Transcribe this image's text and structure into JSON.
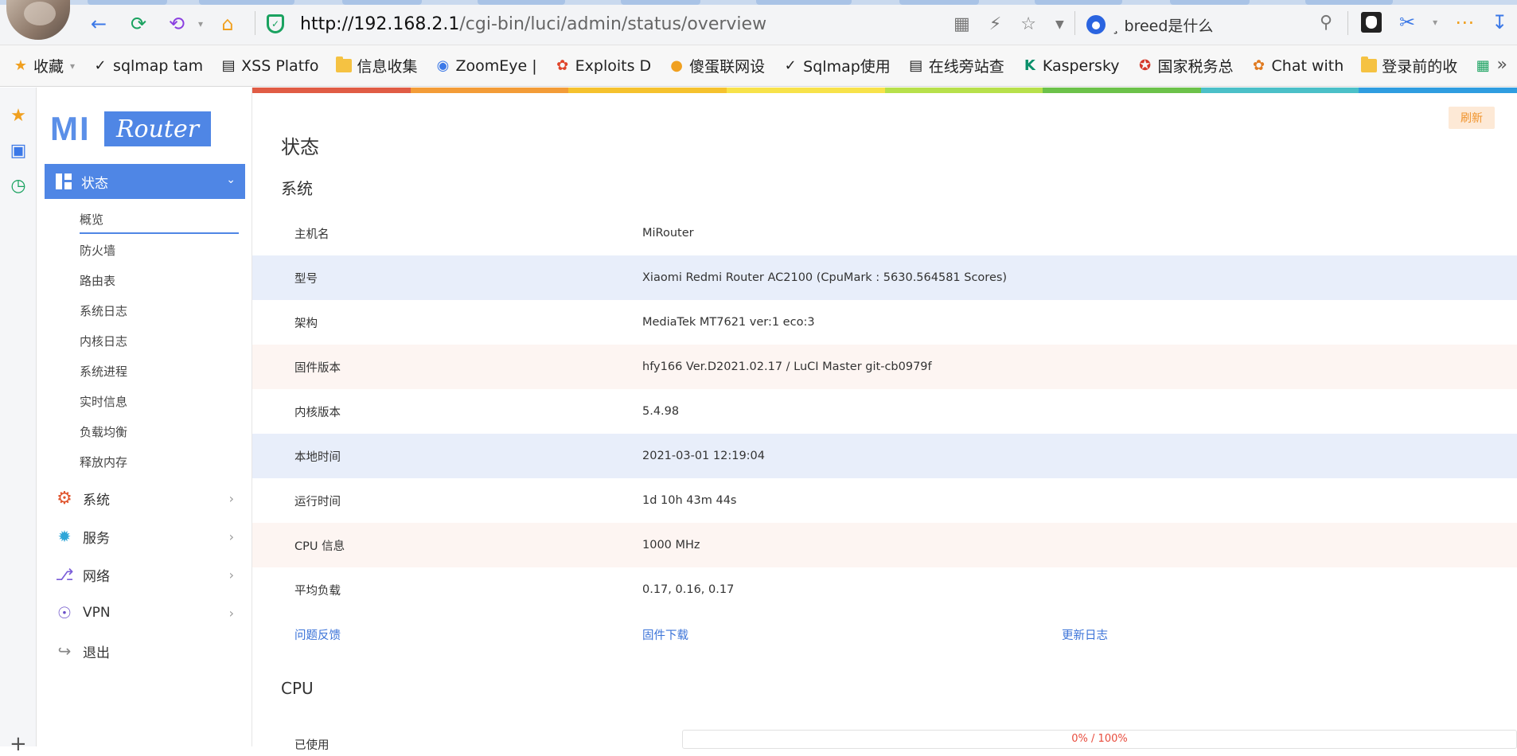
{
  "browser": {
    "url_host": "http://192.168.2.1",
    "url_path": "/cgi-bin/luci/admin/status/overview",
    "search_text": "¸ breed是什么"
  },
  "bookmarks": [
    {
      "label": "收藏",
      "icon": "star-icon"
    },
    {
      "label": "sqlmap tam",
      "icon": "sqlmap-icon"
    },
    {
      "label": "XSS Platfo",
      "icon": "document-icon"
    },
    {
      "label": "信息收集",
      "icon": "folder-icon"
    },
    {
      "label": "ZoomEye |",
      "icon": "eye-icon"
    },
    {
      "label": "Exploits D",
      "icon": "bug-icon"
    },
    {
      "label": "傻蛋联网设",
      "icon": "globe-icon"
    },
    {
      "label": "Sqlmap使用",
      "icon": "sqlmap-icon"
    },
    {
      "label": "在线旁站查",
      "icon": "document-icon"
    },
    {
      "label": "Kaspersky",
      "icon": "kaspersky-icon"
    },
    {
      "label": "国家税务总",
      "icon": "emblem-icon"
    },
    {
      "label": "Chat with",
      "icon": "chat-icon"
    },
    {
      "label": "登录前的收",
      "icon": "folder-icon"
    }
  ],
  "logo": {
    "mi": "MI",
    "router": "Router"
  },
  "menu": {
    "active": "状态",
    "sub": [
      "概览",
      "防火墙",
      "路由表",
      "系统日志",
      "内核日志",
      "系统进程",
      "实时信息",
      "负载均衡",
      "释放内存"
    ],
    "items": [
      "系统",
      "服务",
      "网络",
      "VPN",
      "退出"
    ]
  },
  "page": {
    "refresh": "刷新",
    "title": "状态",
    "section_system": "系统",
    "section_cpu": "CPU"
  },
  "system": [
    {
      "k": "主机名",
      "v": "MiRouter"
    },
    {
      "k": "型号",
      "v": "Xiaomi Redmi Router AC2100 (CpuMark : 5630.564581 Scores)"
    },
    {
      "k": "架构",
      "v": "MediaTek MT7621 ver:1 eco:3"
    },
    {
      "k": "固件版本",
      "v": "hfy166 Ver.D2021.02.17 / LuCI Master git-cb0979f"
    },
    {
      "k": "内核版本",
      "v": "5.4.98"
    },
    {
      "k": "本地时间",
      "v": "2021-03-01 12:19:04"
    },
    {
      "k": "运行时间",
      "v": "1d 10h 43m 44s"
    },
    {
      "k": "CPU 信息",
      "v": "1000 MHz"
    },
    {
      "k": "平均负载",
      "v": "0.17, 0.16, 0.17"
    }
  ],
  "links": {
    "feedback": "问题反馈",
    "download": "固件下载",
    "changelog": "更新日志"
  },
  "cpu": {
    "used_label": "已使用",
    "usage_text": "0% / 100%",
    "usage_fraction": 0
  },
  "colors": {
    "accent": "#4f86e5",
    "rainbow": [
      "#e05c45",
      "#f39c38",
      "#f5c22e",
      "#f7e24a",
      "#b7e04b",
      "#6cc24a",
      "#4bc0c8",
      "#2f9de0"
    ]
  }
}
